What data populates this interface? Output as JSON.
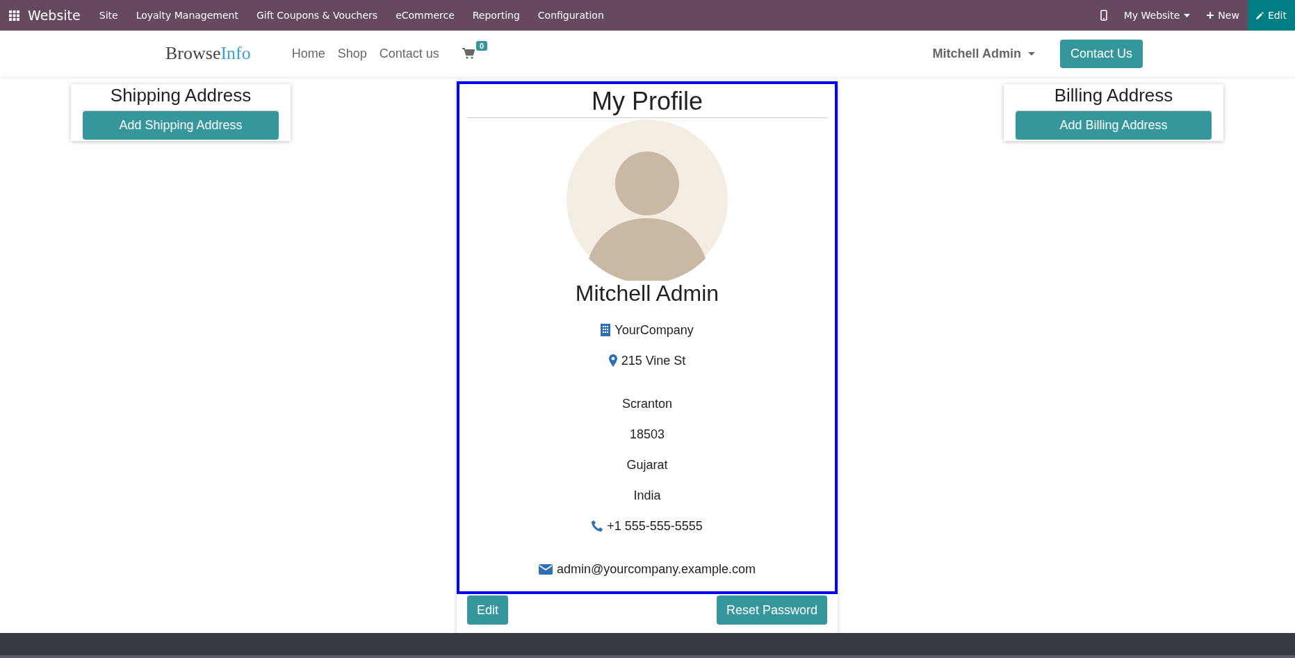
{
  "top_bar": {
    "app_name": "Website",
    "menu": [
      "Site",
      "Loyalty Management",
      "Gift Coupons & Vouchers",
      "eCommerce",
      "Reporting",
      "Configuration"
    ],
    "website_selector": "My Website",
    "new_button": "New",
    "edit_button": "Edit"
  },
  "header": {
    "logo_first": "Browse",
    "logo_second": "Info",
    "nav": [
      "Home",
      "Shop",
      "Contact us"
    ],
    "cart_count": "0",
    "user_menu": "Mitchell Admin",
    "contact_button": "Contact Us"
  },
  "shipping": {
    "title": "Shipping Address",
    "button": "Add Shipping Address"
  },
  "profile": {
    "title": "My Profile",
    "name": "Mitchell Admin",
    "groups": [
      [
        {
          "kind": "company",
          "text": "YourCompany"
        },
        {
          "kind": "address",
          "text": "215 Vine St"
        }
      ],
      [
        {
          "kind": "plain",
          "text": "Scranton"
        },
        {
          "kind": "plain",
          "text": "18503"
        },
        {
          "kind": "plain",
          "text": "Gujarat"
        },
        {
          "kind": "plain",
          "text": "India"
        },
        {
          "kind": "phone",
          "text": "+1 555-555-5555"
        }
      ],
      [
        {
          "kind": "email",
          "text": "admin@yourcompany.example.com"
        }
      ]
    ],
    "edit_button": "Edit",
    "reset_button": "Reset Password"
  },
  "billing": {
    "title": "Billing Address",
    "button": "Add Billing Address"
  }
}
